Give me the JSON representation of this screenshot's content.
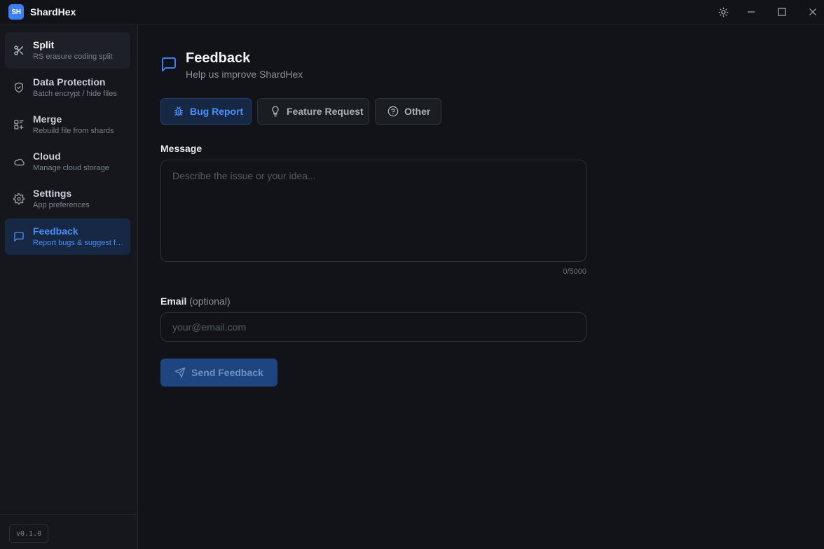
{
  "app": {
    "logo_text": "SH",
    "title": "ShardHex",
    "version": "v0.1.0",
    "accent": "#3d7ef2"
  },
  "window_controls": {
    "icons": [
      "sun-icon",
      "minimize-icon",
      "maximize-icon",
      "close-icon"
    ]
  },
  "sidebar": {
    "items": [
      {
        "label": "Split",
        "sub": "RS erasure coding split",
        "icon": "scissors-icon"
      },
      {
        "label": "Data Protection",
        "sub": "Batch encrypt / hide files",
        "icon": "shield-icon"
      },
      {
        "label": "Merge",
        "sub": "Rebuild file from shards",
        "icon": "merge-icon"
      },
      {
        "label": "Cloud",
        "sub": "Manage cloud storage",
        "icon": "cloud-icon"
      },
      {
        "label": "Settings",
        "sub": "App preferences",
        "icon": "gear-icon"
      },
      {
        "label": "Feedback",
        "sub": "Report bugs & suggest features",
        "icon": "message-icon"
      }
    ],
    "active": "Feedback"
  },
  "page": {
    "title": "Feedback",
    "subtitle": "Help us improve ShardHex"
  },
  "tabs": [
    {
      "label": "Bug Report",
      "icon": "bug-icon",
      "selected": true
    },
    {
      "label": "Feature Request",
      "icon": "lightbulb-icon",
      "selected": false
    },
    {
      "label": "Other",
      "icon": "question-icon",
      "selected": false
    }
  ],
  "message": {
    "label": "Message",
    "placeholder": "Describe the issue or your idea...",
    "value": "",
    "counter": "0/5000"
  },
  "email": {
    "label": "Email",
    "optional": "(optional)",
    "placeholder": "your@email.com",
    "value": ""
  },
  "send_button": {
    "label": "Send Feedback",
    "icon": "send-icon"
  }
}
